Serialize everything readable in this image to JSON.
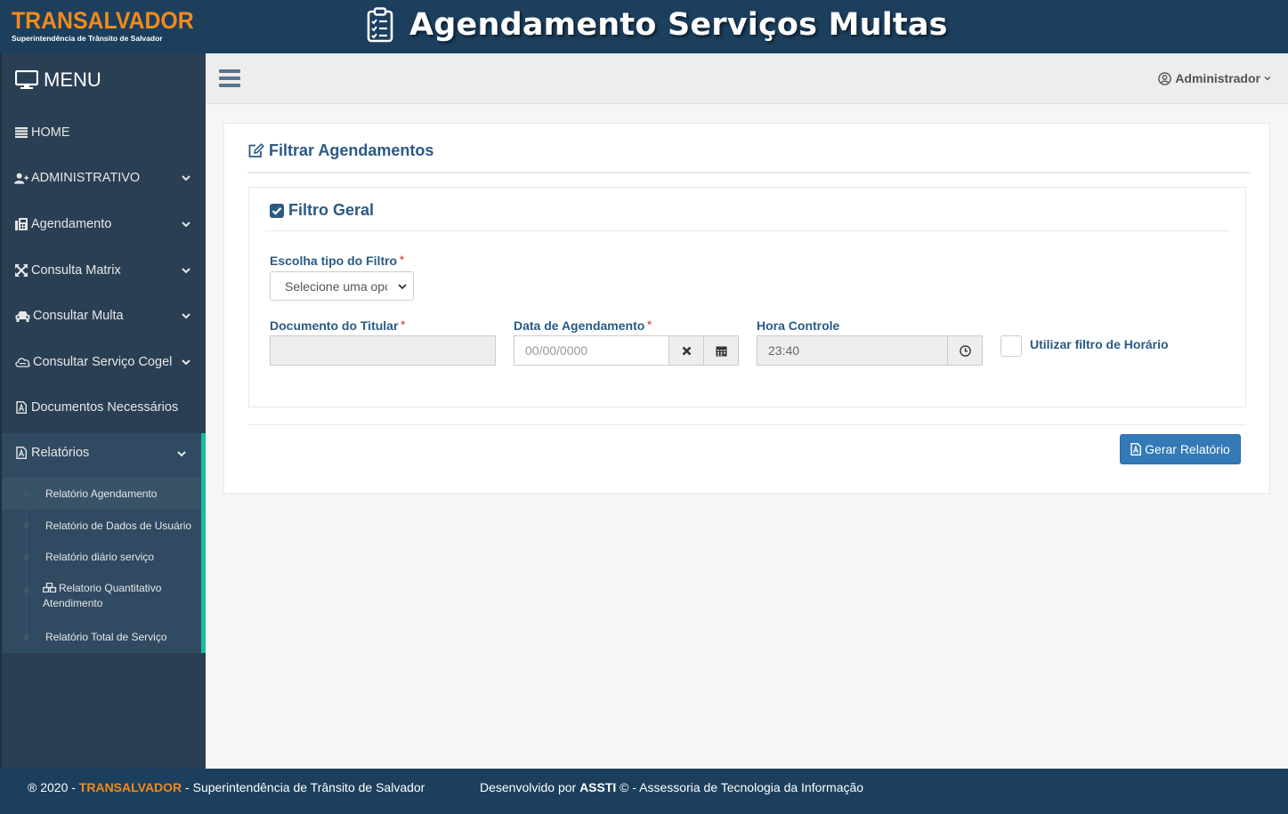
{
  "header": {
    "logo_text": "TRANSALVADOR",
    "logo_subtitle": "Superintendência de Trânsito de Salvador",
    "app_title": "Agendamento Serviços Multas"
  },
  "sidebar": {
    "menu_title": "MENU",
    "items": [
      {
        "label": "HOME",
        "icon": "list-icon"
      },
      {
        "label": "ADMINISTRATIVO",
        "icon": "user-plus-icon"
      },
      {
        "label": "Agendamento",
        "icon": "fax-icon"
      },
      {
        "label": "Consulta Matrix",
        "icon": "expand-icon"
      },
      {
        "label": "Consultar Multa",
        "icon": "car-icon"
      },
      {
        "label": "Consultar Serviço Cogel",
        "icon": "cloud-icon"
      },
      {
        "label": "Documentos Necessários",
        "icon": "file-pdf-icon"
      },
      {
        "label": "Relatórios",
        "icon": "file-pdf-icon"
      }
    ],
    "sub_items": [
      {
        "label": "Relatório Agendamento",
        "active": true
      },
      {
        "label": "Relatório de Dados de Usuário"
      },
      {
        "label": "Relatório diário serviço"
      },
      {
        "label": "Relatorio Quantitativo Atendimento",
        "icon": "cubes-icon"
      },
      {
        "label": "Relatório Total de Serviço"
      }
    ]
  },
  "navbar": {
    "user_label": "Administrador"
  },
  "panel": {
    "title": "Filtrar Agendamentos",
    "filter_title": "Filtro Geral",
    "filter_type_label": "Escolha tipo do Filtro",
    "filter_type_value": "Selecione uma opção",
    "required_mark": "*",
    "documento_label": "Documento do Titular",
    "documento_value": "",
    "data_label": "Data de Agendamento",
    "data_placeholder": "00/00/0000",
    "hora_label": "Hora Controle",
    "hora_value": "23:40",
    "horario_checkbox_label": "Utilizar filtro de Horário",
    "generate_button": "Gerar Relatório"
  },
  "footer": {
    "left_prefix": "® 2020 - ",
    "left_brand": "TRANSALVADOR",
    "left_suffix": " - Superintendência de Trânsito de Salvador",
    "right_prefix": "Desenvolvido por ",
    "right_brand": "ASSTI",
    "right_suffix": " © - Assessoria de Tecnologia da Informação"
  },
  "colors": {
    "header_bg": "#1c3f5e",
    "sidebar_bg": "#2a3f54",
    "brand_orange": "#f28a1a",
    "accent_green": "#1abb9c",
    "title_blue": "#2a5a85",
    "button_blue": "#337ab7"
  }
}
